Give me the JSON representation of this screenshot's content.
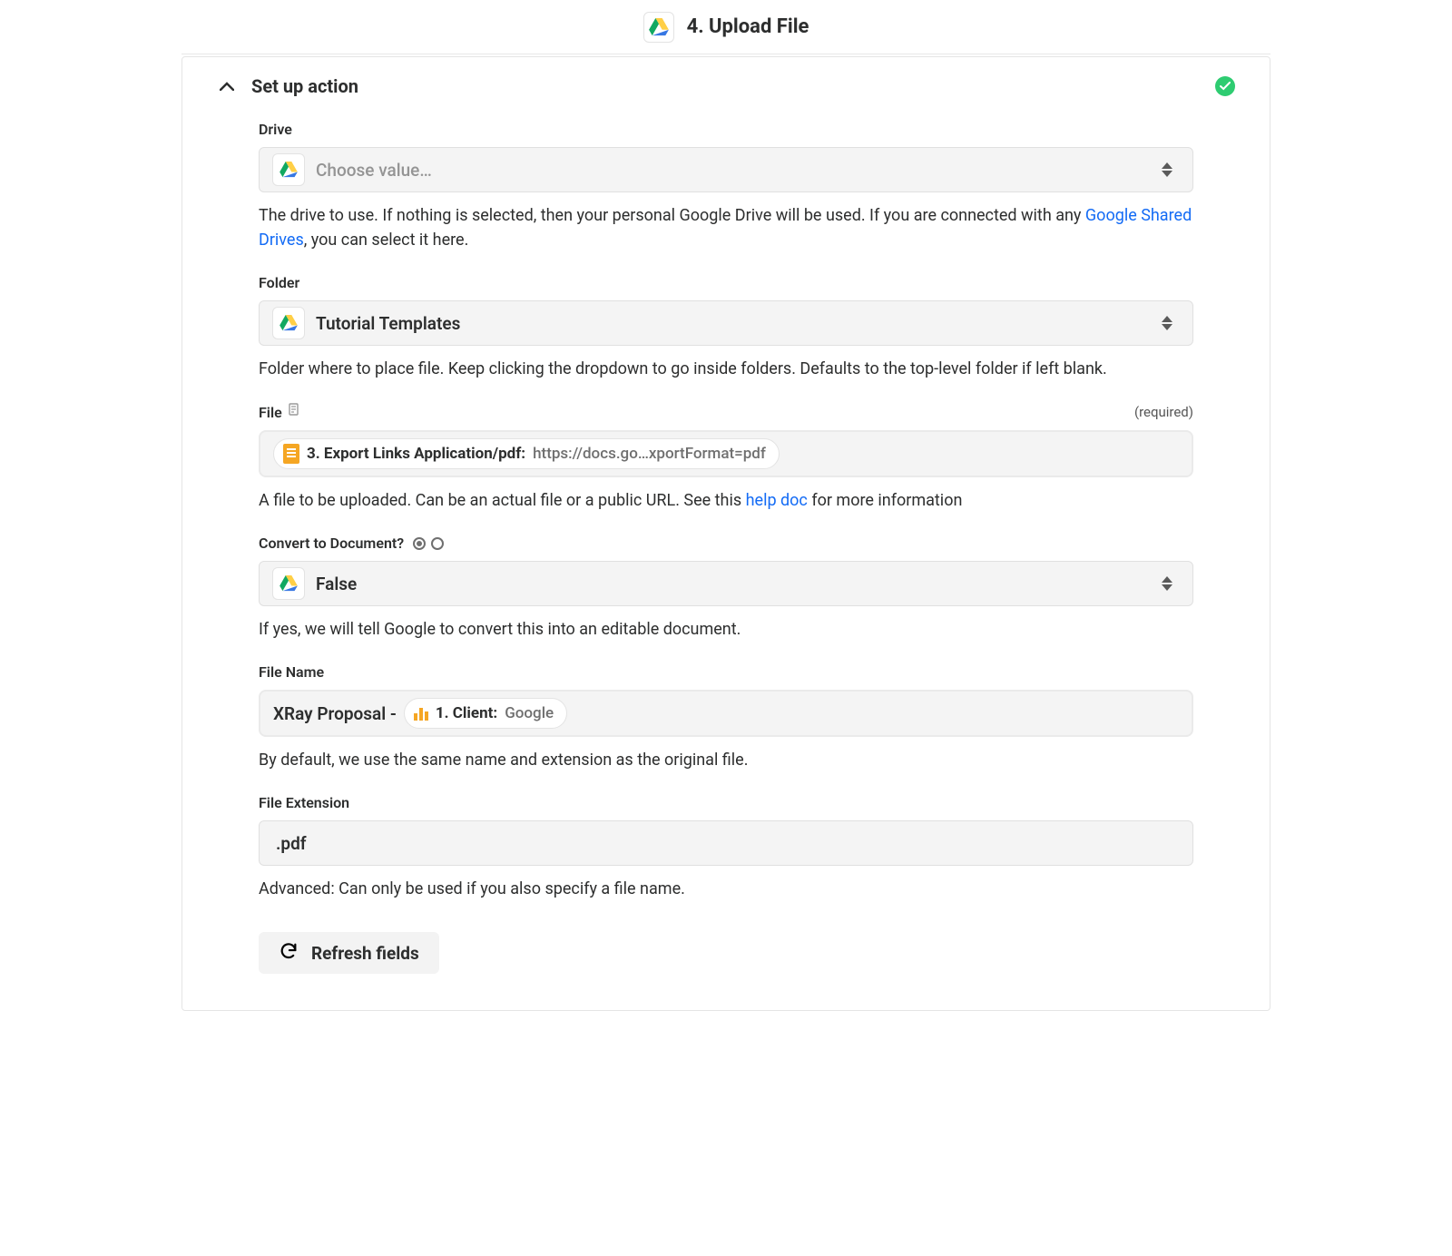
{
  "header": {
    "title": "4. Upload File"
  },
  "section": {
    "title": "Set up action"
  },
  "fields": {
    "drive": {
      "label": "Drive",
      "placeholder": "Choose value…",
      "help_pre": "The drive to use. If nothing is selected, then your personal Google Drive will be used. If you are connected with any ",
      "help_link": "Google Shared Drives",
      "help_post": ", you can select it here."
    },
    "folder": {
      "label": "Folder",
      "value": "Tutorial Templates",
      "help": "Folder where to place file. Keep clicking the dropdown to go inside folders. Defaults to the top-level folder if left blank."
    },
    "file": {
      "label": "File",
      "required_text": "(required)",
      "pill_name": "3. Export Links Application/pdf:",
      "pill_value": "https://docs.go…xportFormat=pdf",
      "help_pre": "A file to be uploaded. Can be an actual file or a public URL. See this ",
      "help_link": "help doc",
      "help_post": " for more information"
    },
    "convert": {
      "label": "Convert to Document?",
      "value": "False",
      "help": "If yes, we will tell Google to convert this into an editable document."
    },
    "filename": {
      "label": "File Name",
      "prefix": "XRay Proposal - ",
      "pill_name": "1. Client:",
      "pill_value": "Google",
      "help": "By default, we use the same name and extension as the original file."
    },
    "ext": {
      "label": "File Extension",
      "value": ".pdf",
      "help": "Advanced: Can only be used if you also specify a file name."
    }
  },
  "buttons": {
    "refresh": "Refresh fields"
  }
}
